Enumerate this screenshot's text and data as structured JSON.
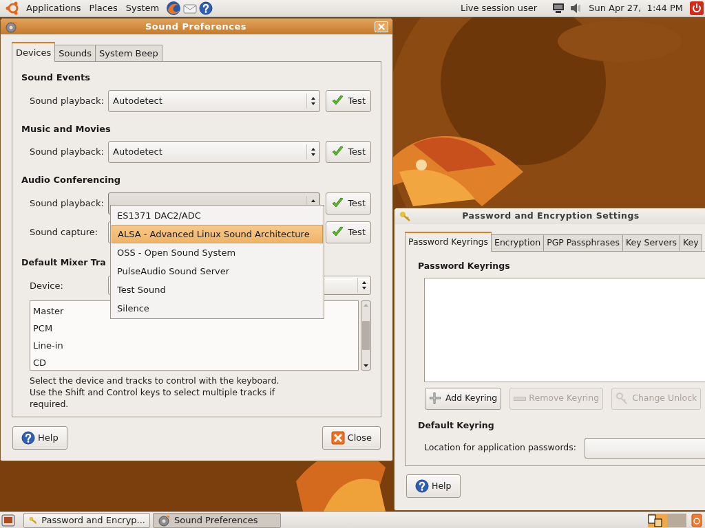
{
  "top_panel": {
    "menus": [
      "Applications",
      "Places",
      "System"
    ],
    "user": "Live session user",
    "clock": "Sun Apr 27,  1:44 PM"
  },
  "sound_window": {
    "title": "Sound Preferences",
    "focused": true,
    "tabs": [
      {
        "label": "Devices",
        "selected": true
      },
      {
        "label": "Sounds",
        "selected": false
      },
      {
        "label": "System Beep",
        "selected": false
      }
    ],
    "sections": [
      {
        "heading": "Sound Events",
        "rows": [
          {
            "label": "Sound playback:",
            "value": "Autodetect",
            "button": "Test"
          }
        ]
      },
      {
        "heading": "Music and Movies",
        "rows": [
          {
            "label": "Sound playback:",
            "value": "Autodetect",
            "button": "Test"
          }
        ]
      },
      {
        "heading": "Audio Conferencing",
        "rows": [
          {
            "label": "Sound playback:",
            "open": true,
            "button": "Test"
          },
          {
            "label": "Sound capture:",
            "button": "Test"
          }
        ]
      }
    ],
    "mixer": {
      "heading": "Default Mixer Tra",
      "device_label": "Device:",
      "tracks": [
        "Master",
        "PCM",
        "Line-in",
        "CD"
      ],
      "hint": "Select the device and tracks to control with the keyboard.\nUse the Shift and Control keys to select multiple tracks if required."
    },
    "help_button": "Help",
    "close_button": "Close"
  },
  "dropdown": {
    "items": [
      {
        "label": "ES1371 DAC2/ADC",
        "selected": false
      },
      {
        "label": "ALSA - Advanced Linux Sound Architecture",
        "selected": true
      },
      {
        "label": "OSS - Open Sound System",
        "selected": false
      },
      {
        "label": "PulseAudio Sound Server",
        "selected": false
      },
      {
        "label": "Test Sound",
        "selected": false
      },
      {
        "label": "Silence",
        "selected": false
      }
    ]
  },
  "password_window": {
    "title": "Password and Encryption Settings",
    "focused": false,
    "tabs": [
      {
        "label": "Password Keyrings",
        "selected": true
      },
      {
        "label": "Encryption",
        "selected": false
      },
      {
        "label": "PGP Passphrases",
        "selected": false
      },
      {
        "label": "Key Servers",
        "selected": false
      },
      {
        "label": "Key",
        "selected": false
      }
    ],
    "heading": "Password Keyrings",
    "buttons": [
      {
        "label": "Add Keyring",
        "kind": "add",
        "disabled": false
      },
      {
        "label": "Remove Keyring",
        "kind": "remove",
        "disabled": true
      },
      {
        "label": "Change Unlock",
        "kind": "unlock",
        "disabled": true
      }
    ],
    "default_heading": "Default Keyring",
    "location_label": "Location for application passwords:",
    "help_button": "Help"
  },
  "taskbar": {
    "tasks": [
      {
        "label": "Password and Encryp...",
        "kind": "keys",
        "selected": false
      },
      {
        "label": "Sound Preferences",
        "kind": "sound",
        "selected": true
      }
    ]
  }
}
